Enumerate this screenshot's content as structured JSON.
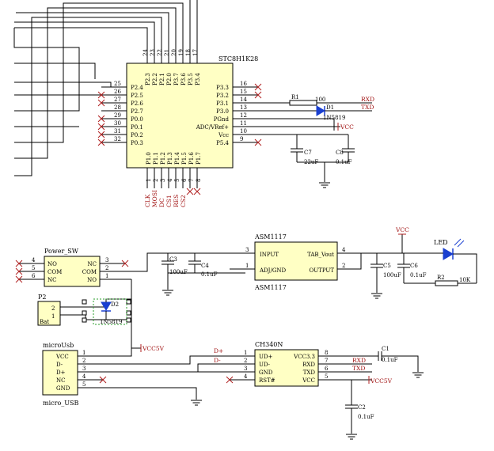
{
  "mcu": {
    "part": "STC8H1K28",
    "top_pins": [
      "24",
      "23",
      "22",
      "21",
      "20",
      "19",
      "18",
      "17"
    ],
    "top_names": [
      "P2.3",
      "P2.2",
      "P2.1",
      "P2.0",
      "P3.7",
      "P3.6",
      "P3.5",
      "P3.4"
    ],
    "left_pins": [
      "25",
      "26",
      "27",
      "28",
      "29",
      "30",
      "31",
      "32"
    ],
    "left_names": [
      "P2.4",
      "P2.5",
      "P2.6",
      "P2.7",
      "P0.0",
      "P0.1",
      "P0.2",
      "P0.3"
    ],
    "right_pins": [
      "16",
      "15",
      "14",
      "13",
      "12",
      "11",
      "10",
      "9"
    ],
    "right_names": [
      "P3.3",
      "P3.2",
      "P3.1",
      "P3.0",
      "PGnd",
      "ADC/VRef+",
      "Vcc",
      "P5.4"
    ],
    "bottom_pins": [
      "1",
      "2",
      "3",
      "4",
      "5",
      "6",
      "7",
      "8"
    ],
    "bottom_names": [
      "P1.0",
      "P1.1",
      "P1.2",
      "P1.3",
      "P1.4",
      "P1.5",
      "P1.6",
      "P1.7"
    ],
    "bottom_nets": [
      "CLK",
      "MOSI",
      "DC",
      "CS1",
      "RES",
      "CS2"
    ]
  },
  "serial": {
    "r1": "R1",
    "r1_val": "100",
    "d1": "D1",
    "d1_part": "1N5819",
    "rxd": "RXD",
    "txd": "TXD",
    "vcc": "VCC",
    "c7": "C7",
    "c7_val": "22uF",
    "c8": "C8",
    "c8_val": "0.1uF"
  },
  "power_sw": {
    "name": "Power_SW",
    "left_pins": [
      "4",
      "5",
      "6"
    ],
    "left_names": [
      "NO",
      "COM",
      "NC"
    ],
    "right_names": [
      "NC",
      "COM",
      "NO"
    ],
    "right_pins": [
      "3",
      "2",
      "1"
    ]
  },
  "p2": {
    "name": "P2",
    "pins": [
      "2",
      "1"
    ],
    "label": "Bat",
    "d2": "D2",
    "d2_part": "1N5819"
  },
  "reg": {
    "c3": "C3",
    "c3_val": "100uF",
    "c4": "C4",
    "c4_val": "0.1uF",
    "name": "ASM1117",
    "part": "ASM1117",
    "pins": [
      "3",
      "1",
      "4",
      "2"
    ],
    "names": [
      "INPUT",
      "ADJ/GND",
      "TAB_Vout",
      "OUTPUT"
    ],
    "c5": "C5",
    "c5_val": "100uF",
    "c6": "C6",
    "c6_val": "0.1uF",
    "vcc": "VCC",
    "led": "LED",
    "r2": "R2",
    "r2_val": "10K"
  },
  "usb": {
    "name": "microUsb",
    "part": "micro_USB",
    "pins": [
      "1",
      "2",
      "3",
      "4",
      "5"
    ],
    "names": [
      "VCC",
      "D-",
      "D+",
      "NC",
      "GND"
    ],
    "vcc5v": "VCC5V",
    "dplus": "D+",
    "dminus": "D-"
  },
  "ch340": {
    "name": "CH340N",
    "left_pins": [
      "1",
      "2",
      "3",
      "4"
    ],
    "left_names": [
      "UD+",
      "UD-",
      "GND",
      "RST#"
    ],
    "right_names": [
      "VCC3.3",
      "RXD",
      "TXD",
      "VCC"
    ],
    "right_pins": [
      "8",
      "7",
      "6",
      "5"
    ],
    "rxd": "RXD",
    "txd": "TXD",
    "c1": "C1",
    "c1_val": "0.1uF",
    "c2": "C2",
    "c2_val": "0.1uF",
    "vcc5v": "VCC5V"
  }
}
